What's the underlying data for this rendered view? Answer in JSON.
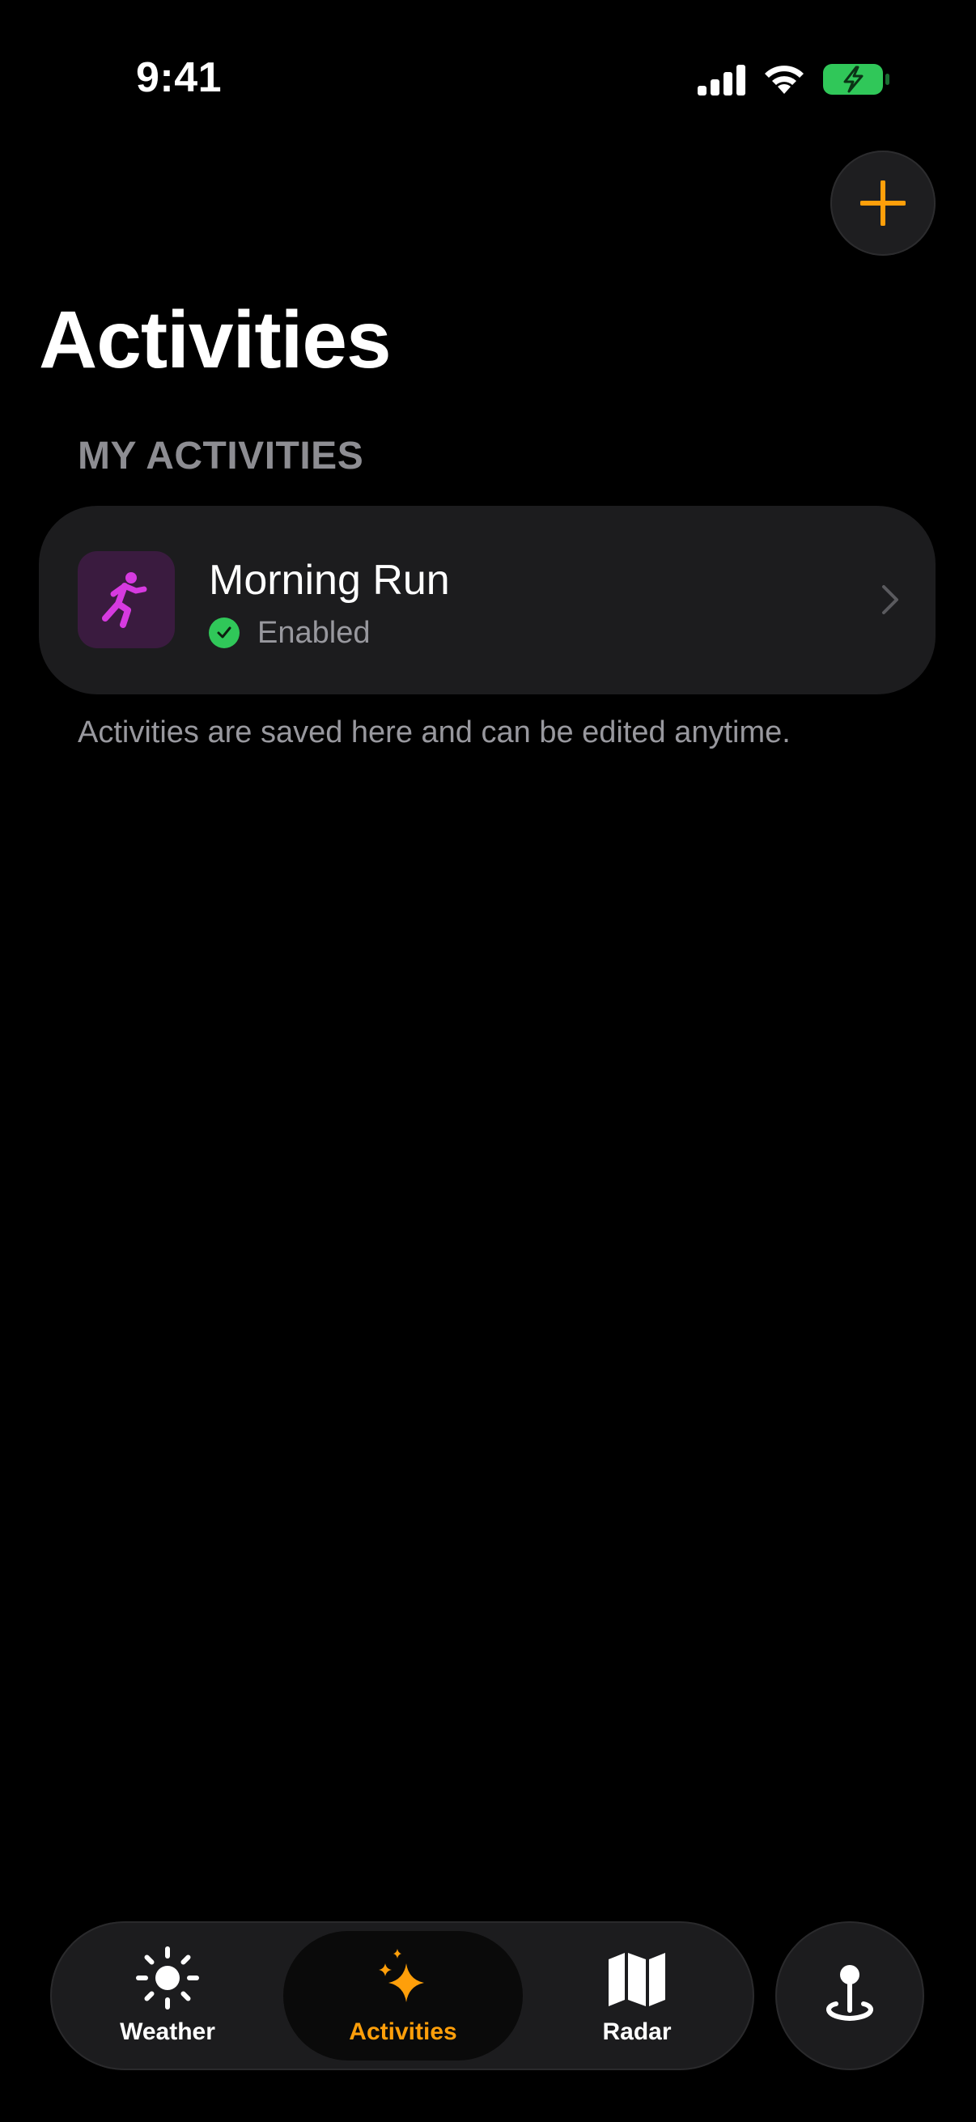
{
  "status_bar": {
    "time": "9:41",
    "icons": [
      "cellular-signal-icon",
      "wifi-icon",
      "battery-charging-icon"
    ],
    "battery_color": "#30c759"
  },
  "header": {
    "add_button_icon": "plus-icon",
    "title": "Activities"
  },
  "activities_section": {
    "header": "MY ACTIVITIES",
    "items": [
      {
        "name": "Morning Run",
        "icon": "running-figure-icon",
        "icon_color": "#d63ae0",
        "status": "Enabled",
        "status_icon": "checkmark-circle-icon",
        "status_color": "#30c759"
      }
    ],
    "footer": "Activities are saved here and can be edited anytime."
  },
  "tab_bar": {
    "accent_color": "#ff9f0a",
    "tabs": [
      {
        "label": "Weather",
        "icon": "sun-icon",
        "selected": false
      },
      {
        "label": "Activities",
        "icon": "sparkles-icon",
        "selected": true
      },
      {
        "label": "Radar",
        "icon": "map-icon",
        "selected": false
      }
    ],
    "location_button_icon": "location-pin-icon"
  }
}
